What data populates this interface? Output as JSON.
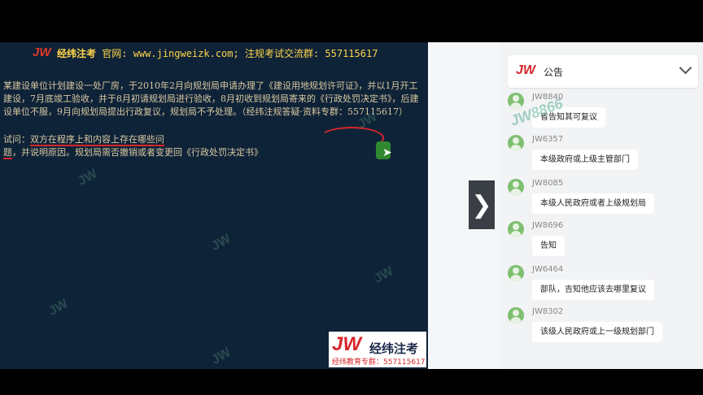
{
  "slide": {
    "logo": "JW",
    "header_brand": "经纬注考",
    "header_rest": " 官网: www.jingweizk.com; 注规考试交流群: 557115617",
    "body": "某建设单位计划建设一处厂房，于2010年2月向规划局申请办理了《建设用地规划许可证》，并以1月开工建设，7月底竣工验收，并于8月初请规划局进行验收，8月初收到规划局寄来的《行政处罚决定书》，后建设单位不服，9月向规划局提出行政复议，规划局不予处理。（经纬注规答疑·资料专群：557115617）",
    "question_prefix": "试问：",
    "question_underlined": "双方在程序上和内容上存在哪些问题",
    "question_rest": "，并说明原因。规划局需否撤销或者变更回《行政处罚决定书》",
    "watermark": "JW",
    "brand_box": {
      "jw": "JW",
      "name": "经纬注考",
      "sub": "经纬教育专群：557115617"
    }
  },
  "toggle": {
    "icon": "chevron-right-icon",
    "glyph": "❯"
  },
  "panel": {
    "notice": {
      "jw": "JW",
      "label": "公告"
    },
    "overlay_watermark": "JW8866",
    "messages": [
      {
        "user": "JW8840",
        "text": "省告知其可复议"
      },
      {
        "user": "JW6357",
        "text": "本级政府或上级主管部门"
      },
      {
        "user": "JW8085",
        "text": "本级人民政府或者上级规划局"
      },
      {
        "user": "JW8696",
        "text": "告知"
      },
      {
        "user": "JW6464",
        "text": "部队，吉知他应该去哪里复议"
      },
      {
        "user": "JW8302",
        "text": "该级人民政府或上一级规划部门"
      }
    ]
  },
  "colors": {
    "slide_bg": "#0f2338",
    "accent_red": "#d7262b",
    "header_yellow": "#ffd54a",
    "panel_bg": "#f2f3f5"
  }
}
